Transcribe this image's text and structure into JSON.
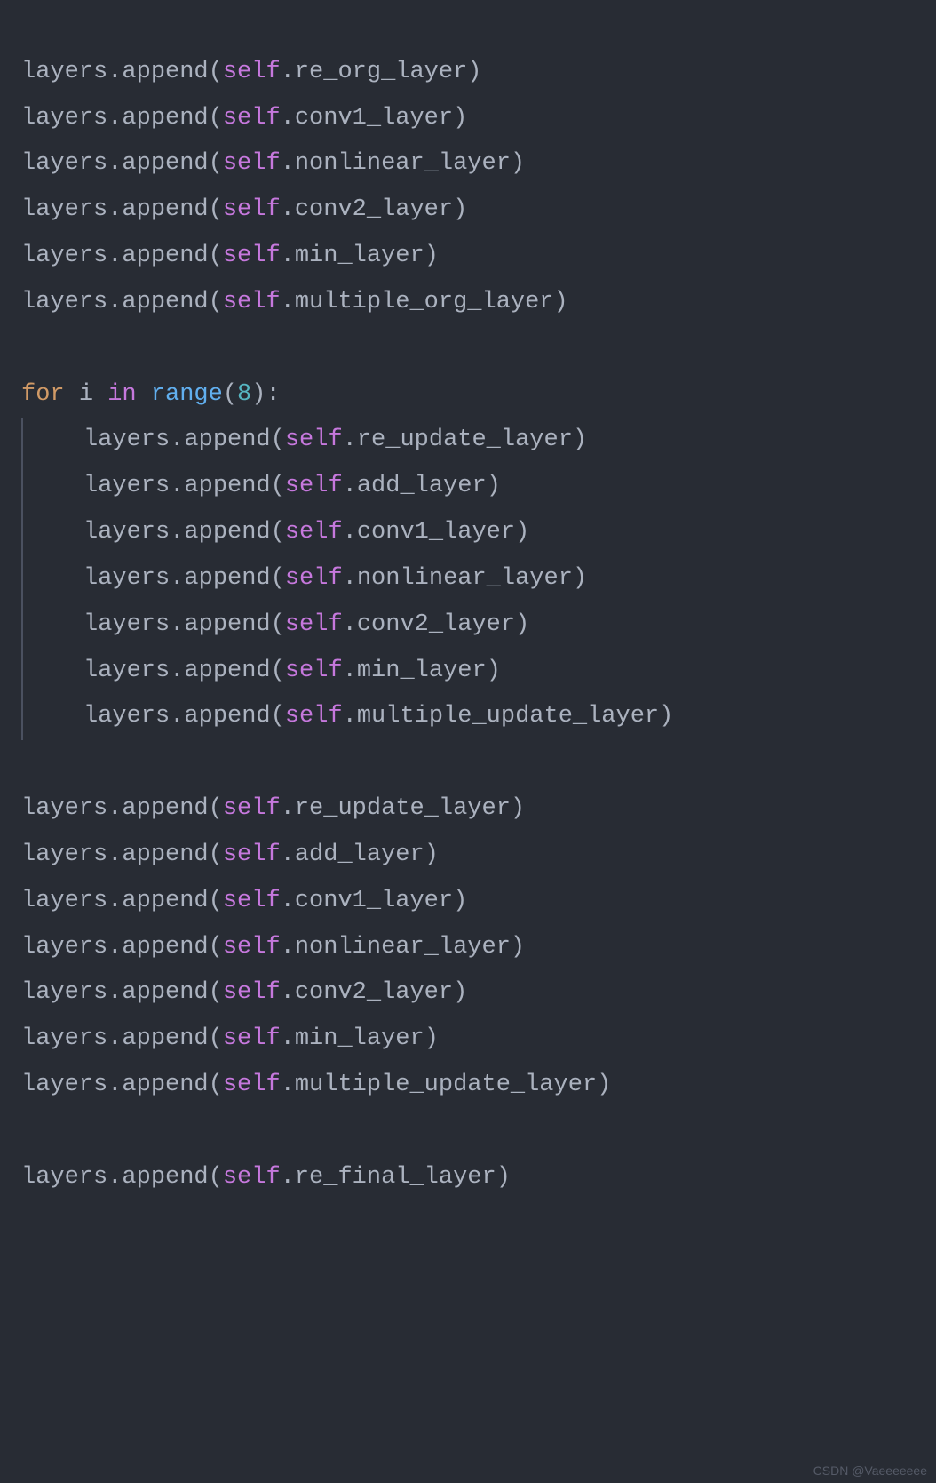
{
  "code": {
    "block1": [
      "layers.append(self.re_org_layer)",
      "layers.append(self.conv1_layer)",
      "layers.append(self.nonlinear_layer)",
      "layers.append(self.conv2_layer)",
      "layers.append(self.min_layer)",
      "layers.append(self.multiple_org_layer)"
    ],
    "for_header": "for i in range(8):",
    "for_kw": "for",
    "for_var": "i",
    "for_in": "in",
    "for_func": "range",
    "for_arg": "8",
    "block_loop": [
      "layers.append(self.re_update_layer)",
      "layers.append(self.add_layer)",
      "layers.append(self.conv1_layer)",
      "layers.append(self.nonlinear_layer)",
      "layers.append(self.conv2_layer)",
      "layers.append(self.min_layer)",
      "layers.append(self.multiple_update_layer)"
    ],
    "block3": [
      "layers.append(self.re_update_layer)",
      "layers.append(self.add_layer)",
      "layers.append(self.conv1_layer)",
      "layers.append(self.nonlinear_layer)",
      "layers.append(self.conv2_layer)",
      "layers.append(self.min_layer)",
      "layers.append(self.multiple_update_layer)"
    ],
    "block4": [
      "layers.append(self.re_final_layer)"
    ]
  },
  "watermark": "CSDN @Vaeeeeeee"
}
